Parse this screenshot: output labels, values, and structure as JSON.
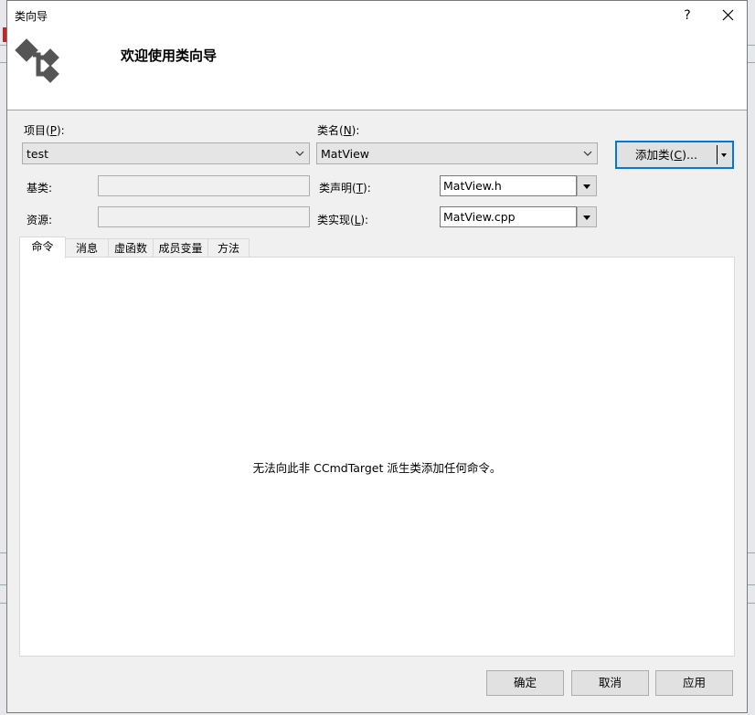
{
  "window": {
    "title": "类向导",
    "help_label": "?"
  },
  "banner": {
    "heading": "欢迎使用类向导"
  },
  "project": {
    "label_pre": "项目(",
    "label_key": "P",
    "label_post": "):",
    "value": "test"
  },
  "classname": {
    "label_pre": "类名(",
    "label_key": "N",
    "label_post": "):",
    "value": "MatView"
  },
  "add_class": {
    "label_pre": "添加类(",
    "label_key": "C",
    "label_post": ")..."
  },
  "base_class": {
    "label": "基类:",
    "value": ""
  },
  "resource": {
    "label": "资源:",
    "value": ""
  },
  "class_decl": {
    "label_pre": "类声明(",
    "label_key": "T",
    "label_post": "):",
    "value": "MatView.h"
  },
  "class_impl": {
    "label_pre": "类实现(",
    "label_key": "L",
    "label_post": "):",
    "value": "MatView.cpp"
  },
  "tabs": [
    {
      "label": "命令"
    },
    {
      "label": "消息"
    },
    {
      "label": "虚函数"
    },
    {
      "label": "成员变量"
    },
    {
      "label": "方法"
    }
  ],
  "panel": {
    "message": "无法向此非 CCmdTarget 派生类添加任何命令。"
  },
  "buttons": {
    "ok": "确定",
    "cancel": "取消",
    "apply": "应用"
  }
}
